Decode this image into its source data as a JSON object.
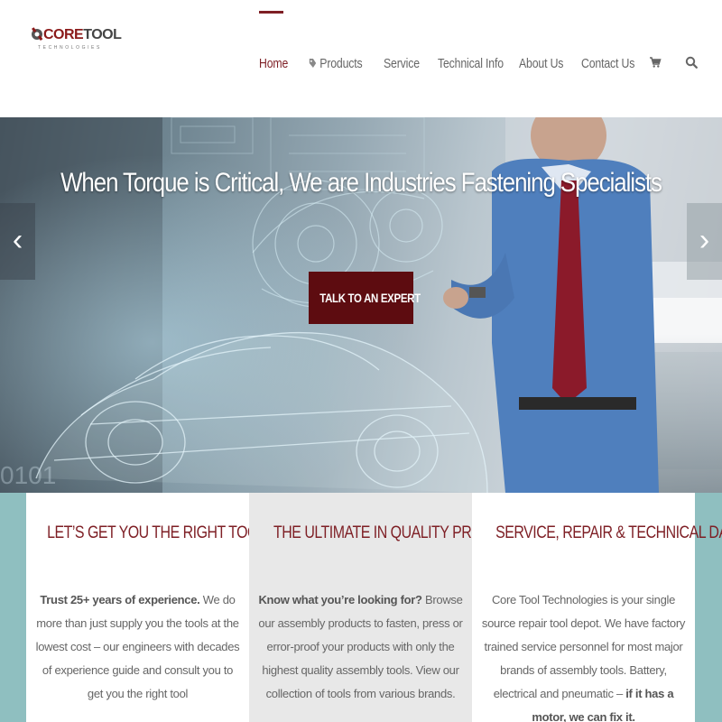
{
  "logo": {
    "brand_core": "CORE",
    "brand_tool": "TOOL",
    "tagline": "TECHNOLOGIES"
  },
  "nav": {
    "items": [
      {
        "label": "Home",
        "active": true
      },
      {
        "label": "Products",
        "icon": "tag-icon"
      },
      {
        "label": "Service"
      },
      {
        "label": "Technical Info"
      },
      {
        "label": "About Us"
      },
      {
        "label": "Contact Us"
      }
    ],
    "cart_icon": "cart-icon",
    "search_icon": "search-icon"
  },
  "hero": {
    "title": "When Torque is Critical, We are Industries Fastening Specialists",
    "cta_label": "TALK TO AN EXPERT",
    "prev_arrow": "‹",
    "next_arrow": "›"
  },
  "features": [
    {
      "title": "LET’S GET YOU THE RIGHT TOOL",
      "body_bold": "Trust 25+ years of experience.",
      "body_text": " We do more than just supply you the tools at the lowest cost – our engineers with decades of experience guide and consult you to get you the right tool"
    },
    {
      "title": "THE ULTIMATE IN QUALITY PRODUCTS",
      "body_bold": "Know what you’re looking for?",
      "body_text": " Browse our assembly products to fasten, press or error-proof your products with only the highest quality assembly tools. View our collection of tools from various brands."
    },
    {
      "title": "SERVICE, REPAIR & TECHNICAL DATA",
      "body_text": "Core Tool Technologies is your single source repair tool depot. We have factory trained service personnel for most major brands of assembly tools. Battery, electrical and pneumatic – ",
      "body_bold": "if it has a motor, we can fix it."
    }
  ],
  "colors": {
    "accent": "#7e1f25",
    "cta_bg": "#5d0c10",
    "teal_band": "#8fbfc0"
  }
}
